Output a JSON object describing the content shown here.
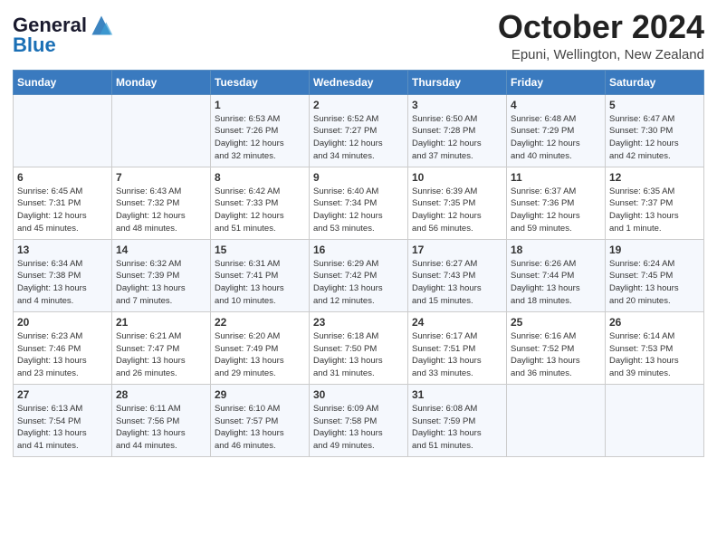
{
  "header": {
    "logo_line1": "General",
    "logo_line2": "Blue",
    "month": "October 2024",
    "location": "Epuni, Wellington, New Zealand"
  },
  "days_of_week": [
    "Sunday",
    "Monday",
    "Tuesday",
    "Wednesday",
    "Thursday",
    "Friday",
    "Saturday"
  ],
  "weeks": [
    [
      {
        "day": "",
        "info": ""
      },
      {
        "day": "",
        "info": ""
      },
      {
        "day": "1",
        "info": "Sunrise: 6:53 AM\nSunset: 7:26 PM\nDaylight: 12 hours\nand 32 minutes."
      },
      {
        "day": "2",
        "info": "Sunrise: 6:52 AM\nSunset: 7:27 PM\nDaylight: 12 hours\nand 34 minutes."
      },
      {
        "day": "3",
        "info": "Sunrise: 6:50 AM\nSunset: 7:28 PM\nDaylight: 12 hours\nand 37 minutes."
      },
      {
        "day": "4",
        "info": "Sunrise: 6:48 AM\nSunset: 7:29 PM\nDaylight: 12 hours\nand 40 minutes."
      },
      {
        "day": "5",
        "info": "Sunrise: 6:47 AM\nSunset: 7:30 PM\nDaylight: 12 hours\nand 42 minutes."
      }
    ],
    [
      {
        "day": "6",
        "info": "Sunrise: 6:45 AM\nSunset: 7:31 PM\nDaylight: 12 hours\nand 45 minutes."
      },
      {
        "day": "7",
        "info": "Sunrise: 6:43 AM\nSunset: 7:32 PM\nDaylight: 12 hours\nand 48 minutes."
      },
      {
        "day": "8",
        "info": "Sunrise: 6:42 AM\nSunset: 7:33 PM\nDaylight: 12 hours\nand 51 minutes."
      },
      {
        "day": "9",
        "info": "Sunrise: 6:40 AM\nSunset: 7:34 PM\nDaylight: 12 hours\nand 53 minutes."
      },
      {
        "day": "10",
        "info": "Sunrise: 6:39 AM\nSunset: 7:35 PM\nDaylight: 12 hours\nand 56 minutes."
      },
      {
        "day": "11",
        "info": "Sunrise: 6:37 AM\nSunset: 7:36 PM\nDaylight: 12 hours\nand 59 minutes."
      },
      {
        "day": "12",
        "info": "Sunrise: 6:35 AM\nSunset: 7:37 PM\nDaylight: 13 hours\nand 1 minute."
      }
    ],
    [
      {
        "day": "13",
        "info": "Sunrise: 6:34 AM\nSunset: 7:38 PM\nDaylight: 13 hours\nand 4 minutes."
      },
      {
        "day": "14",
        "info": "Sunrise: 6:32 AM\nSunset: 7:39 PM\nDaylight: 13 hours\nand 7 minutes."
      },
      {
        "day": "15",
        "info": "Sunrise: 6:31 AM\nSunset: 7:41 PM\nDaylight: 13 hours\nand 10 minutes."
      },
      {
        "day": "16",
        "info": "Sunrise: 6:29 AM\nSunset: 7:42 PM\nDaylight: 13 hours\nand 12 minutes."
      },
      {
        "day": "17",
        "info": "Sunrise: 6:27 AM\nSunset: 7:43 PM\nDaylight: 13 hours\nand 15 minutes."
      },
      {
        "day": "18",
        "info": "Sunrise: 6:26 AM\nSunset: 7:44 PM\nDaylight: 13 hours\nand 18 minutes."
      },
      {
        "day": "19",
        "info": "Sunrise: 6:24 AM\nSunset: 7:45 PM\nDaylight: 13 hours\nand 20 minutes."
      }
    ],
    [
      {
        "day": "20",
        "info": "Sunrise: 6:23 AM\nSunset: 7:46 PM\nDaylight: 13 hours\nand 23 minutes."
      },
      {
        "day": "21",
        "info": "Sunrise: 6:21 AM\nSunset: 7:47 PM\nDaylight: 13 hours\nand 26 minutes."
      },
      {
        "day": "22",
        "info": "Sunrise: 6:20 AM\nSunset: 7:49 PM\nDaylight: 13 hours\nand 29 minutes."
      },
      {
        "day": "23",
        "info": "Sunrise: 6:18 AM\nSunset: 7:50 PM\nDaylight: 13 hours\nand 31 minutes."
      },
      {
        "day": "24",
        "info": "Sunrise: 6:17 AM\nSunset: 7:51 PM\nDaylight: 13 hours\nand 33 minutes."
      },
      {
        "day": "25",
        "info": "Sunrise: 6:16 AM\nSunset: 7:52 PM\nDaylight: 13 hours\nand 36 minutes."
      },
      {
        "day": "26",
        "info": "Sunrise: 6:14 AM\nSunset: 7:53 PM\nDaylight: 13 hours\nand 39 minutes."
      }
    ],
    [
      {
        "day": "27",
        "info": "Sunrise: 6:13 AM\nSunset: 7:54 PM\nDaylight: 13 hours\nand 41 minutes."
      },
      {
        "day": "28",
        "info": "Sunrise: 6:11 AM\nSunset: 7:56 PM\nDaylight: 13 hours\nand 44 minutes."
      },
      {
        "day": "29",
        "info": "Sunrise: 6:10 AM\nSunset: 7:57 PM\nDaylight: 13 hours\nand 46 minutes."
      },
      {
        "day": "30",
        "info": "Sunrise: 6:09 AM\nSunset: 7:58 PM\nDaylight: 13 hours\nand 49 minutes."
      },
      {
        "day": "31",
        "info": "Sunrise: 6:08 AM\nSunset: 7:59 PM\nDaylight: 13 hours\nand 51 minutes."
      },
      {
        "day": "",
        "info": ""
      },
      {
        "day": "",
        "info": ""
      }
    ]
  ]
}
